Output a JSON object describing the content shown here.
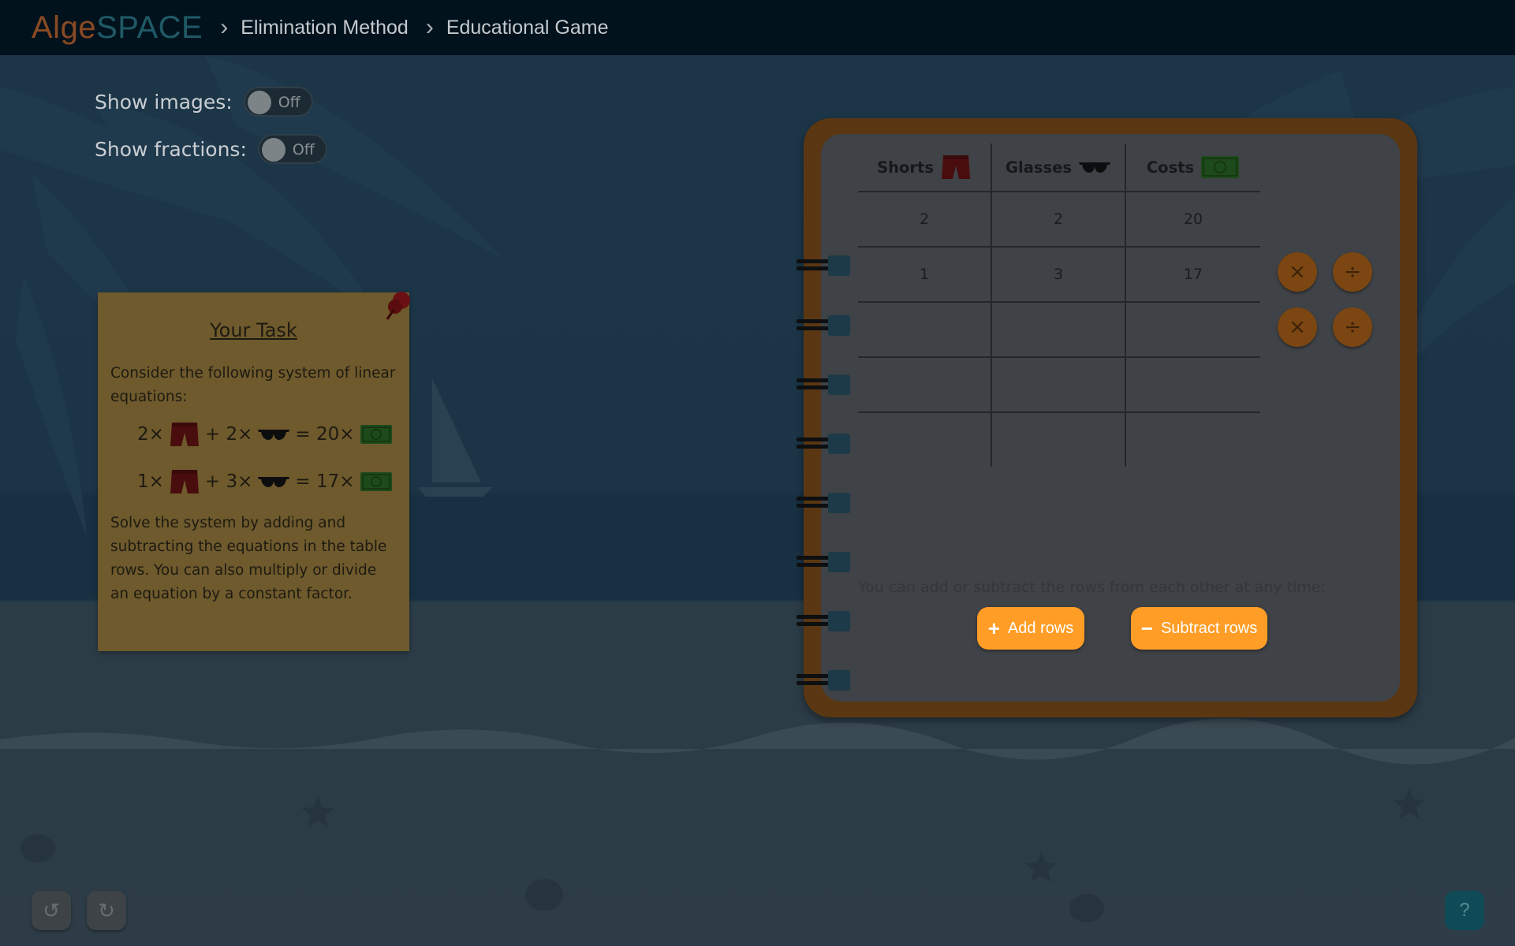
{
  "app": {
    "logo_part1": "Alge",
    "logo_part2": "SPACE"
  },
  "breadcrumb": {
    "items": [
      "Elimination Method",
      "Educational Game"
    ]
  },
  "settings": {
    "show_images": {
      "label": "Show images:",
      "state": "Off"
    },
    "show_fractions": {
      "label": "Show fractions:",
      "state": "Off"
    }
  },
  "task": {
    "title": "Your Task",
    "intro": "Consider the following system of linear equations:",
    "equations": [
      {
        "a": "2×",
        "b": "+ 2×",
        "c": "= 20×"
      },
      {
        "a": "1×",
        "b": "+ 3×",
        "c": "= 17×"
      }
    ],
    "outro": "Solve the system by adding and subtracting the equations in the table rows. You can also multiply or divide an equation by a constant factor."
  },
  "table": {
    "headers": [
      "Shorts",
      "Glasses",
      "Costs"
    ],
    "header_icons": [
      "shorts-icon",
      "glasses-icon",
      "money-icon"
    ],
    "rows": [
      [
        "2",
        "2",
        "20"
      ],
      [
        "1",
        "3",
        "17"
      ],
      [
        "",
        "",
        ""
      ],
      [
        "",
        "",
        ""
      ],
      [
        "",
        "",
        ""
      ]
    ],
    "row_actions": {
      "multiply": "×",
      "divide": "÷"
    }
  },
  "hint": "You can add or subtract the rows from each other at any time:",
  "actions": {
    "add_rows": "Add rows",
    "subtract_rows": "Subtract rows",
    "add_symbol": "+",
    "subtract_symbol": "−"
  },
  "controls": {
    "undo": "↺",
    "redo": "↻",
    "help": "?"
  },
  "colors": {
    "accent": "#ff9d26",
    "topbar": "#02121c",
    "overlay_dim": "#1b3346"
  }
}
